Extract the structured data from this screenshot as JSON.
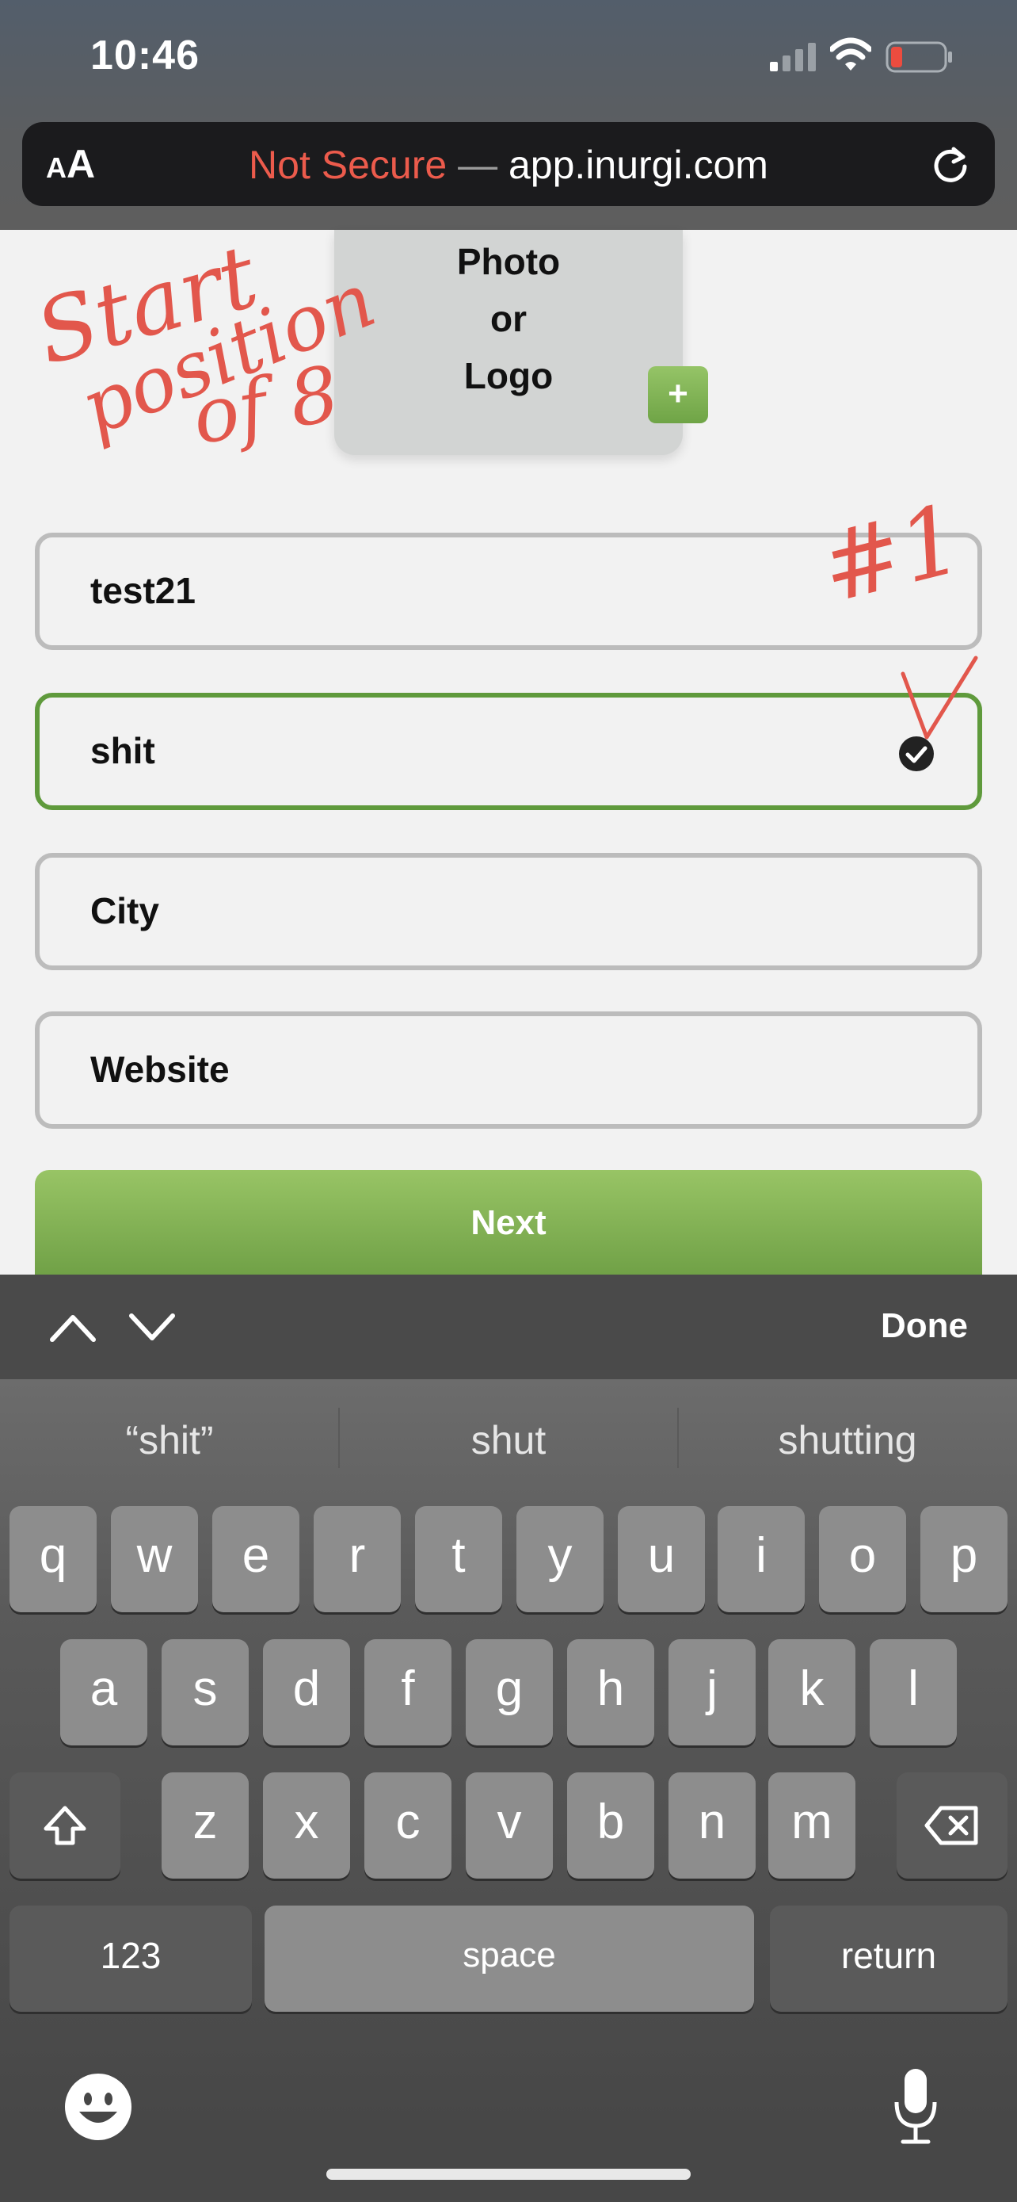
{
  "status_bar": {
    "time": "10:46"
  },
  "browser": {
    "text_size_label_small": "A",
    "text_size_label_large": "A",
    "not_secure_label": "Not Secure",
    "separator": "—",
    "domain": "app.inurgi.com"
  },
  "form": {
    "photo_label_lines": [
      "Photo",
      "or",
      "Logo"
    ],
    "add_photo_label": "+",
    "fields": [
      {
        "value": "test21"
      },
      {
        "value": "shit",
        "state": "active-valid"
      },
      {
        "value": "City"
      },
      {
        "value": "Website"
      }
    ],
    "next_label": "Next"
  },
  "annotations": {
    "handwriting_lines": [
      "Start",
      "position",
      "of 8"
    ],
    "number_tag": "#1"
  },
  "keyboard": {
    "done_label": "Done",
    "suggestions": [
      "“shit”",
      "shut",
      "shutting"
    ],
    "row1": [
      "q",
      "w",
      "e",
      "r",
      "t",
      "y",
      "u",
      "i",
      "o",
      "p"
    ],
    "row2": [
      "a",
      "s",
      "d",
      "f",
      "g",
      "h",
      "j",
      "k",
      "l"
    ],
    "row3": [
      "z",
      "x",
      "c",
      "v",
      "b",
      "n",
      "m"
    ],
    "numbers_label": "123",
    "space_label": "space",
    "return_label": "return"
  },
  "colors": {
    "accent_green": "#6fa446",
    "not_secure_red": "#ec5b4c",
    "annotation_red": "#e2574c"
  },
  "icons": [
    "signal-icon",
    "wifi-icon",
    "battery-icon",
    "reload-icon",
    "check-circle-icon",
    "chevron-up-icon",
    "chevron-down-icon",
    "shift-icon",
    "delete-icon",
    "emoji-icon",
    "mic-icon"
  ]
}
